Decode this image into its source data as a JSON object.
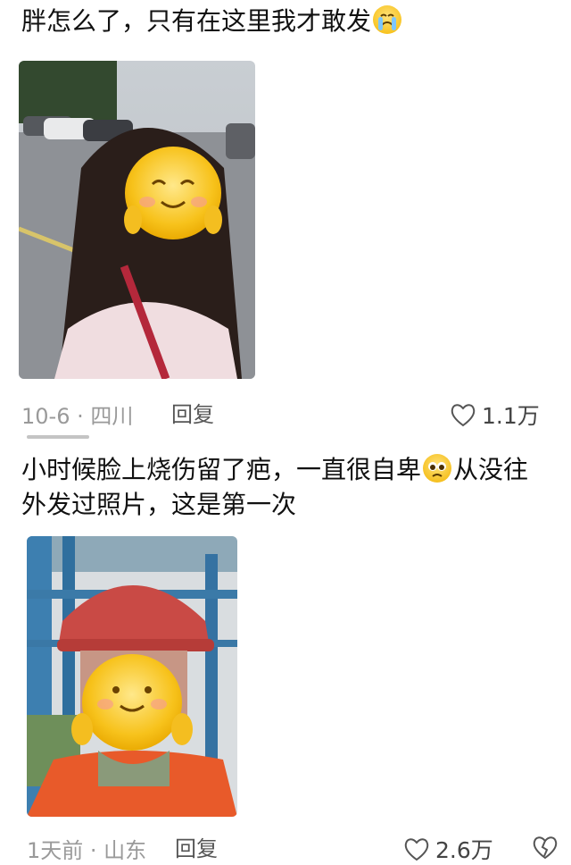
{
  "comments": [
    {
      "text": "胖怎么了，只有在这里我才敢发",
      "emoji": "crying-face",
      "meta": "10-6 · 四川",
      "reply_label": "回复",
      "likes": "1.1万"
    },
    {
      "text_line1": "小时候脸上烧伤留了疤，一直很自卑",
      "emoji": "pleading-face",
      "text_line1_after": "从没往",
      "text_line2": "外发过照片，这是第一次",
      "meta": "1天前 · 山东",
      "reply_label": "回复",
      "likes": "2.6万"
    }
  ],
  "icons": {
    "heart": "heart-outline-icon",
    "dislike": "broken-heart-icon"
  },
  "colors": {
    "meta_gray": "#9a9a9a",
    "sticker_yellow": "#f5c518"
  }
}
